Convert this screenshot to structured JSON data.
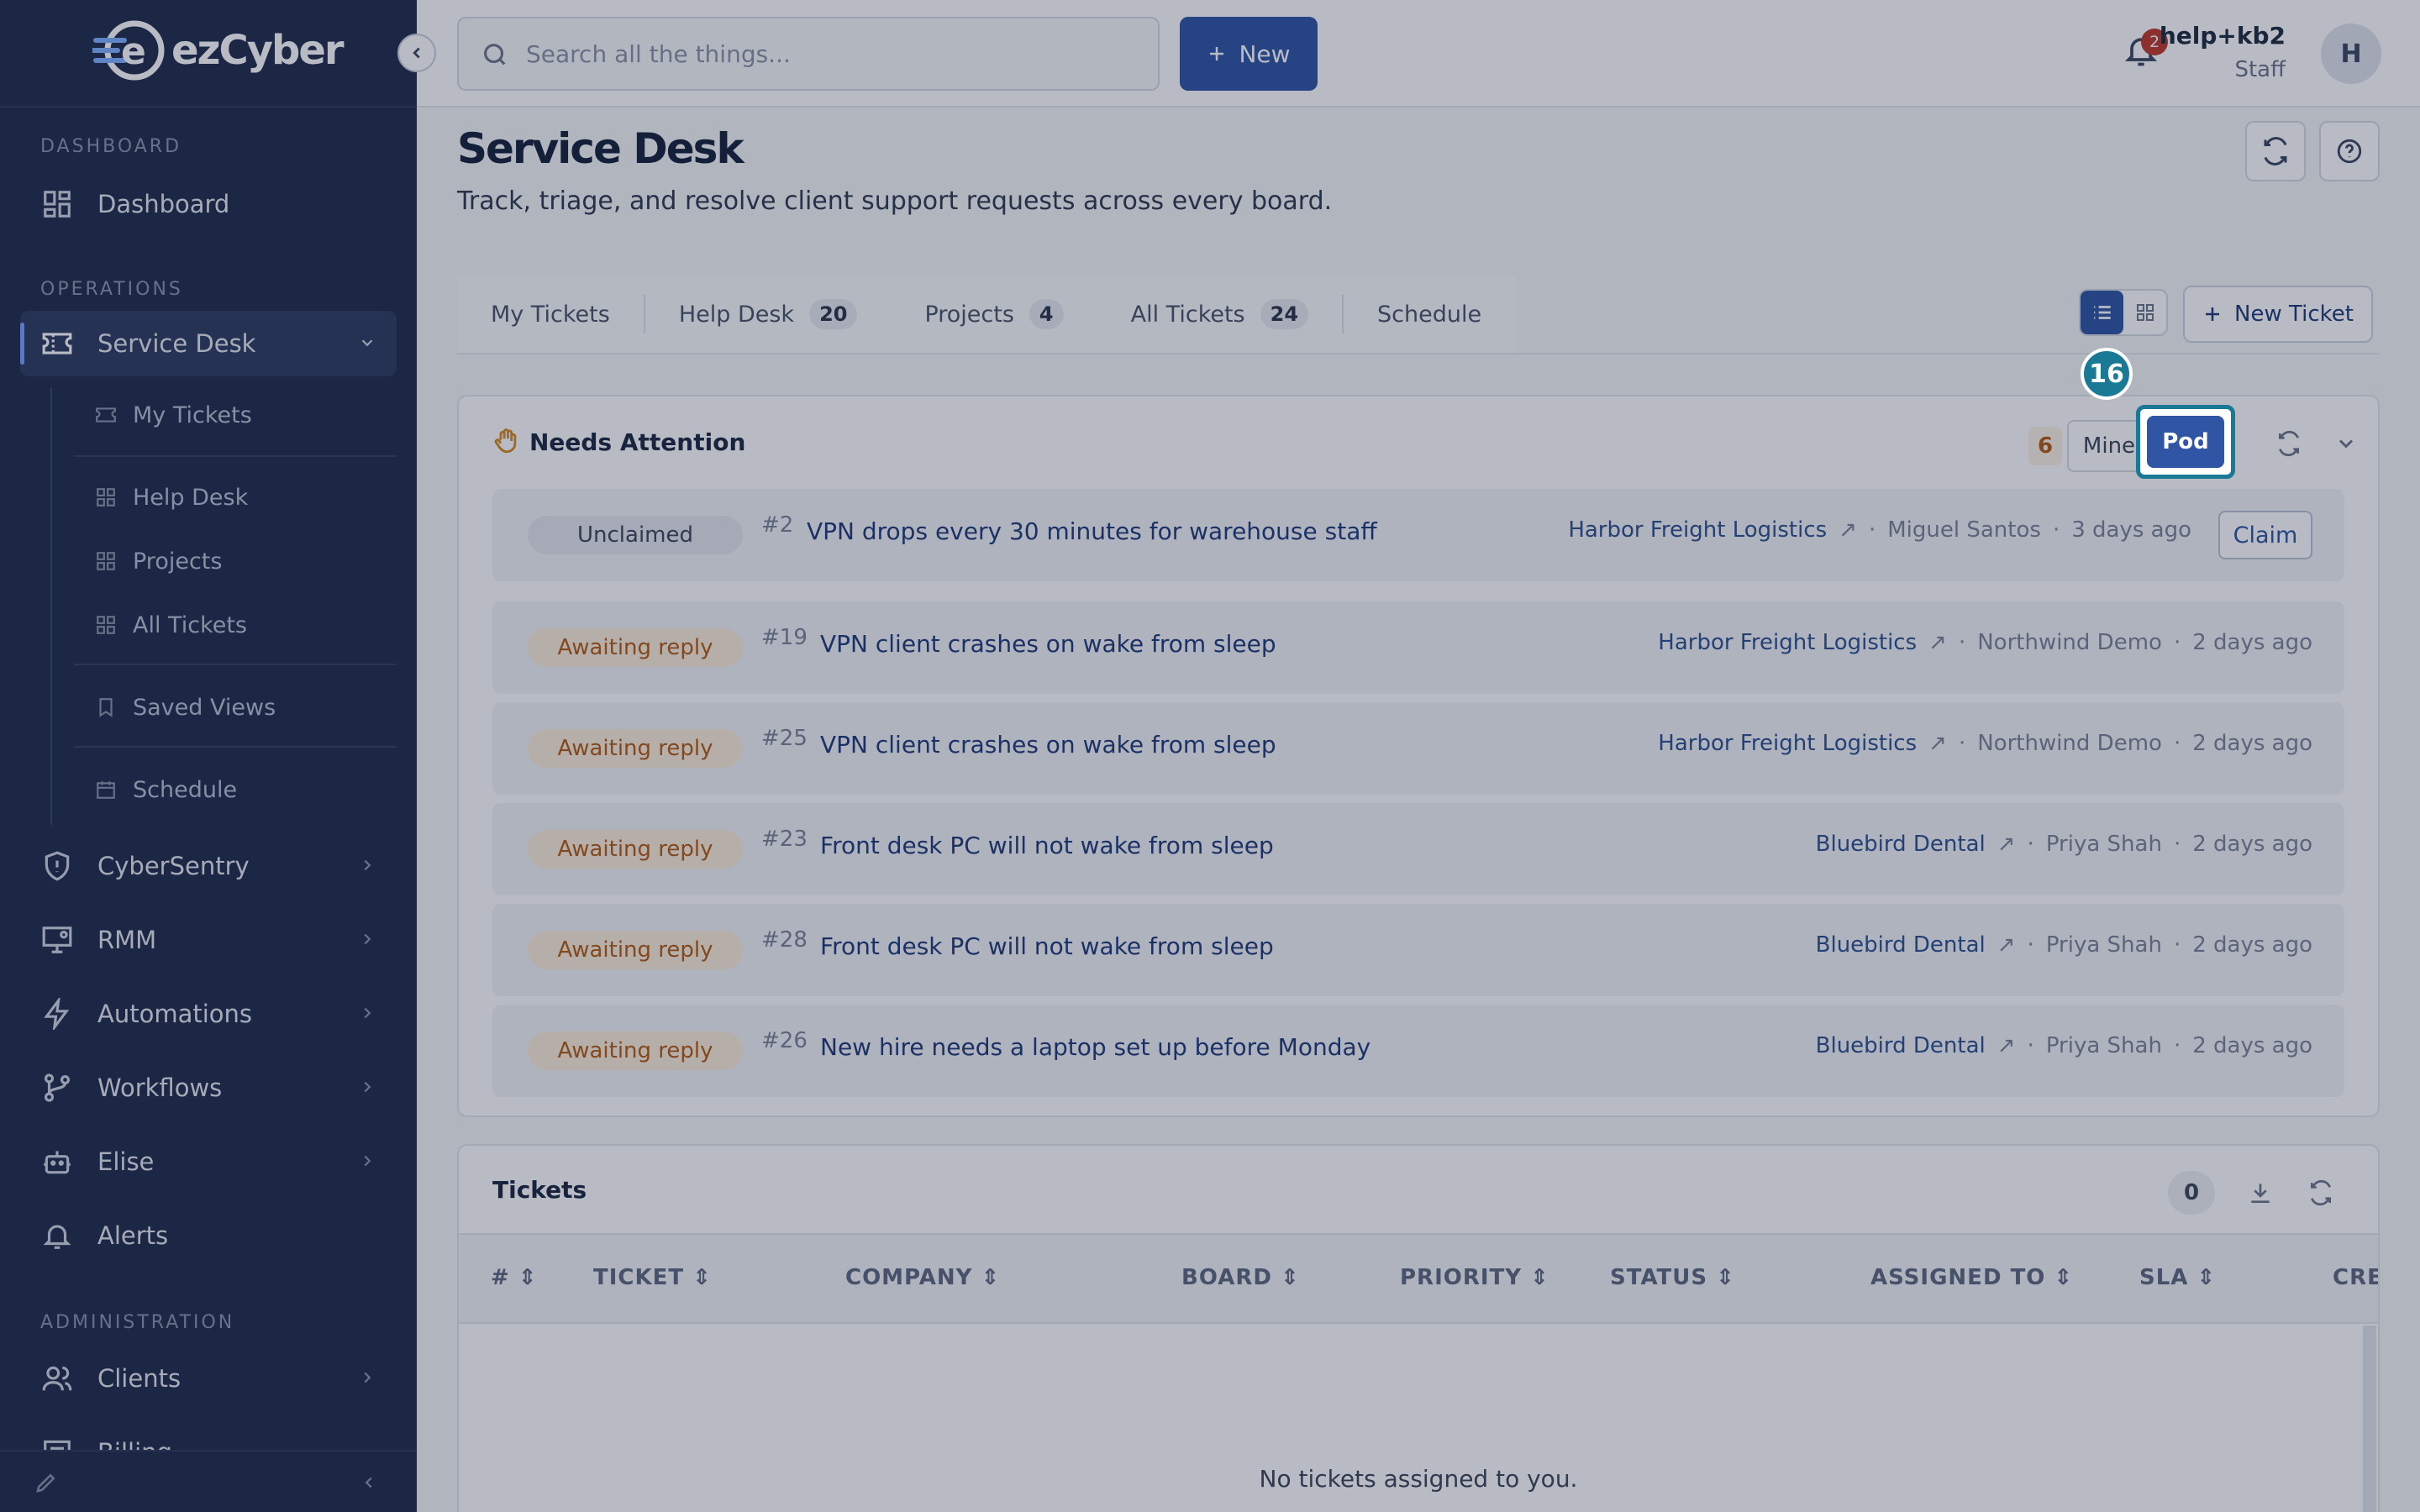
{
  "sidebar": {
    "logo_text": "ezCyber",
    "sections": {
      "dashboard": "DASHBOARD",
      "operations": "OPERATIONS",
      "administration": "ADMINISTRATION"
    },
    "items": {
      "dashboard": "Dashboard",
      "service_desk": "Service Desk",
      "cybersentry": "CyberSentry",
      "rmm": "RMM",
      "automations": "Automations",
      "workflows": "Workflows",
      "elise": "Elise",
      "alerts": "Alerts",
      "clients": "Clients",
      "billing": "Billing"
    },
    "sub_items": {
      "my_tickets": "My Tickets",
      "help_desk": "Help Desk",
      "projects": "Projects",
      "all_tickets": "All Tickets",
      "saved_views": "Saved Views",
      "schedule": "Schedule"
    }
  },
  "topbar": {
    "search_placeholder": "Search all the things...",
    "new_label": "New",
    "notification_count": "2",
    "user_name": "help+kb2",
    "user_role": "Staff",
    "avatar_initial": "H"
  },
  "page": {
    "title": "Service Desk",
    "subtitle": "Track, triage, and resolve client support requests across every board."
  },
  "tabs": [
    {
      "label": "My Tickets",
      "count": ""
    },
    {
      "label": "Help Desk",
      "count": "20"
    },
    {
      "label": "Projects",
      "count": "4"
    },
    {
      "label": "All Tickets",
      "count": "24"
    },
    {
      "label": "Schedule",
      "count": ""
    }
  ],
  "new_ticket_label": "New Ticket",
  "tutorial_step": "16",
  "needs_attention": {
    "title": "Needs Attention",
    "count": "6",
    "mine_label": "Mine",
    "pod_label": "Pod",
    "claim_label": "Claim",
    "rows": [
      {
        "status": "Unclaimed",
        "num": "#2",
        "title": "VPN drops every 30 minutes for warehouse staff",
        "company": "Harbor Freight Logistics",
        "person": "Miguel Santos",
        "age": "3 days ago"
      },
      {
        "status": "Awaiting reply",
        "num": "#19",
        "title": "VPN client crashes on wake from sleep",
        "company": "Harbor Freight Logistics",
        "person": "Northwind Demo",
        "age": "2 days ago"
      },
      {
        "status": "Awaiting reply",
        "num": "#25",
        "title": "VPN client crashes on wake from sleep",
        "company": "Harbor Freight Logistics",
        "person": "Northwind Demo",
        "age": "2 days ago"
      },
      {
        "status": "Awaiting reply",
        "num": "#23",
        "title": "Front desk PC will not wake from sleep",
        "company": "Bluebird Dental",
        "person": "Priya Shah",
        "age": "2 days ago"
      },
      {
        "status": "Awaiting reply",
        "num": "#28",
        "title": "Front desk PC will not wake from sleep",
        "company": "Bluebird Dental",
        "person": "Priya Shah",
        "age": "2 days ago"
      },
      {
        "status": "Awaiting reply",
        "num": "#26",
        "title": "New hire needs a laptop set up before Monday",
        "company": "Bluebird Dental",
        "person": "Priya Shah",
        "age": "2 days ago"
      }
    ]
  },
  "tickets": {
    "title": "Tickets",
    "count": "0",
    "columns": [
      "#",
      "TICKET",
      "COMPANY",
      "BOARD",
      "PRIORITY",
      "STATUS",
      "ASSIGNED TO",
      "SLA",
      "CRE"
    ],
    "empty_text": "No tickets assigned to you."
  },
  "colors": {
    "sidebar": "#1f2b4a",
    "primary": "#2f55a4",
    "awaiting": "#b45b12",
    "highlight": "#1a7a96"
  }
}
